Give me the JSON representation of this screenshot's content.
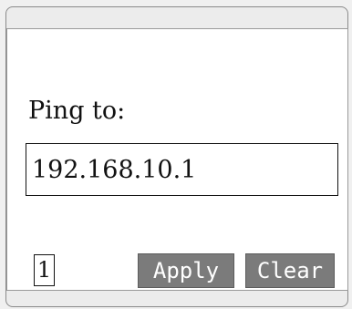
{
  "ping": {
    "label": "Ping to:",
    "ip_value": "192.168.10.1"
  },
  "footer": {
    "page_number": "1",
    "apply_label": "Apply",
    "clear_label": "Clear"
  },
  "colors": {
    "button_bg": "#7b7b7b",
    "button_text": "#ffffff",
    "screen_bg": "#ffffff",
    "frame_bg": "#ececec"
  }
}
